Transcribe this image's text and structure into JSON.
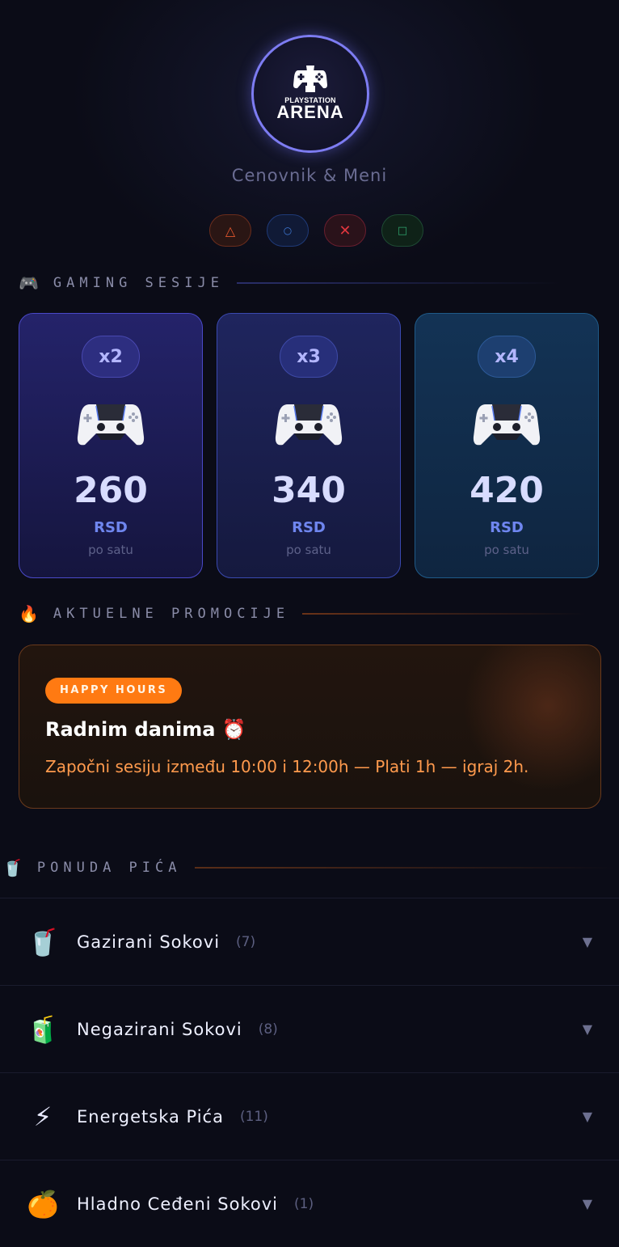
{
  "header": {
    "logo_small": "PLAYSTATION",
    "logo_big": "ARENA",
    "subtitle": "Cenovnik & Meni",
    "symbols": [
      "△",
      "○",
      "✕",
      "□"
    ]
  },
  "sections": {
    "gaming": {
      "icon": "🎮",
      "title": "GAMING SESIJE"
    },
    "promo": {
      "icon": "🔥",
      "title": "AKTUELNE PROMOCIJE"
    },
    "drinks": {
      "icon": "🥤",
      "title": "PONUDA PIĆA"
    }
  },
  "gaming_cards": [
    {
      "badge": "x2",
      "price": "260",
      "currency": "RSD",
      "per": "po satu"
    },
    {
      "badge": "x3",
      "price": "340",
      "currency": "RSD",
      "per": "po satu"
    },
    {
      "badge": "x4",
      "price": "420",
      "currency": "RSD",
      "per": "po satu"
    }
  ],
  "promo": {
    "tag": "HAPPY HOURS",
    "title": "Radnim danima ⏰",
    "description": "Započni sesiju između 10:00 i 12:00h — Plati 1h — igraj 2h."
  },
  "drinks": [
    {
      "icon": "🥤",
      "name": "Gazirani Sokovi",
      "count": "(7)"
    },
    {
      "icon": "🧃",
      "name": "Negazirani Sokovi",
      "count": "(8)"
    },
    {
      "icon": "⚡",
      "name": "Energetska Pića",
      "count": "(11)"
    },
    {
      "icon": "🍊",
      "name": "Hladno Ceđeni Sokovi",
      "count": "(1)"
    }
  ],
  "chevron": "▼"
}
